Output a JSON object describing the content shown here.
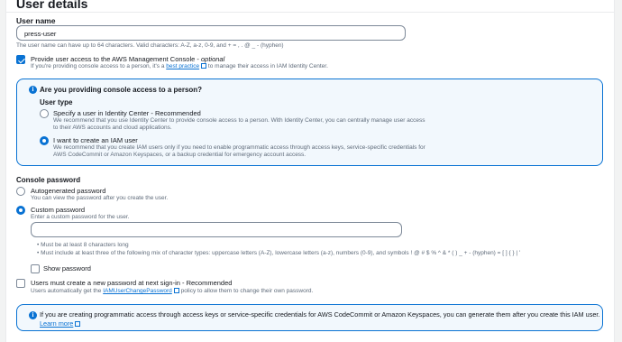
{
  "section": {
    "title": "User details"
  },
  "username": {
    "label": "User name",
    "value": "press-user",
    "hint": "The user name can have up to 64 characters. Valid characters: A-Z, a-z, 0-9, and + = , . @ _ - (hyphen)"
  },
  "console_access": {
    "label": "Provide user access to the AWS Management Console - ",
    "optional": "optional",
    "desc_prefix": "If you're providing console access to a person, it's a ",
    "desc_link": "best practice",
    "desc_suffix": " to manage their access in IAM Identity Center."
  },
  "person_box": {
    "question": "Are you providing console access to a person?",
    "user_type_label": "User type",
    "option1_label": "Specify a user in Identity Center - Recommended",
    "option1_desc1": "We recommend that you use Identity Center to provide console access to a person. With Identity Center, you can centrally manage user access",
    "option1_desc2": "to their AWS accounts and cloud applications.",
    "option2_label": "I want to create an IAM user",
    "option2_desc1": "We recommend that you create IAM users only if you need to enable programmatic access through access keys, service-specific credentials for",
    "option2_desc2": "AWS CodeCommit or Amazon Keyspaces, or a backup credential for emergency account access."
  },
  "password": {
    "label": "Console password",
    "auto_label": "Autogenerated password",
    "auto_desc": "You can view the password after you create the user.",
    "custom_label": "Custom password",
    "custom_desc": "Enter a custom password for the user.",
    "rule1": "Must be at least 8 characters long",
    "rule2": "Must include at least three of the following mix of character types: uppercase letters (A-Z), lowercase letters (a-z), numbers (0-9), and symbols ! @ # $ % ^ & * ( ) _ + - (hyphen) = [ ] { } | '",
    "show_label": "Show password"
  },
  "reset": {
    "label": "Users must create a new password at next sign-in - Recommended",
    "desc_prefix": "Users automatically get the ",
    "desc_link": "IAMUserChangePassword",
    "desc_suffix": " policy to allow them to change their own password."
  },
  "bottom_info": {
    "text": "If you are creating programmatic access through access keys or service-specific credentials for AWS CodeCommit or Amazon Keyspaces, you can generate them after you create this IAM user.",
    "link": "Learn more"
  }
}
